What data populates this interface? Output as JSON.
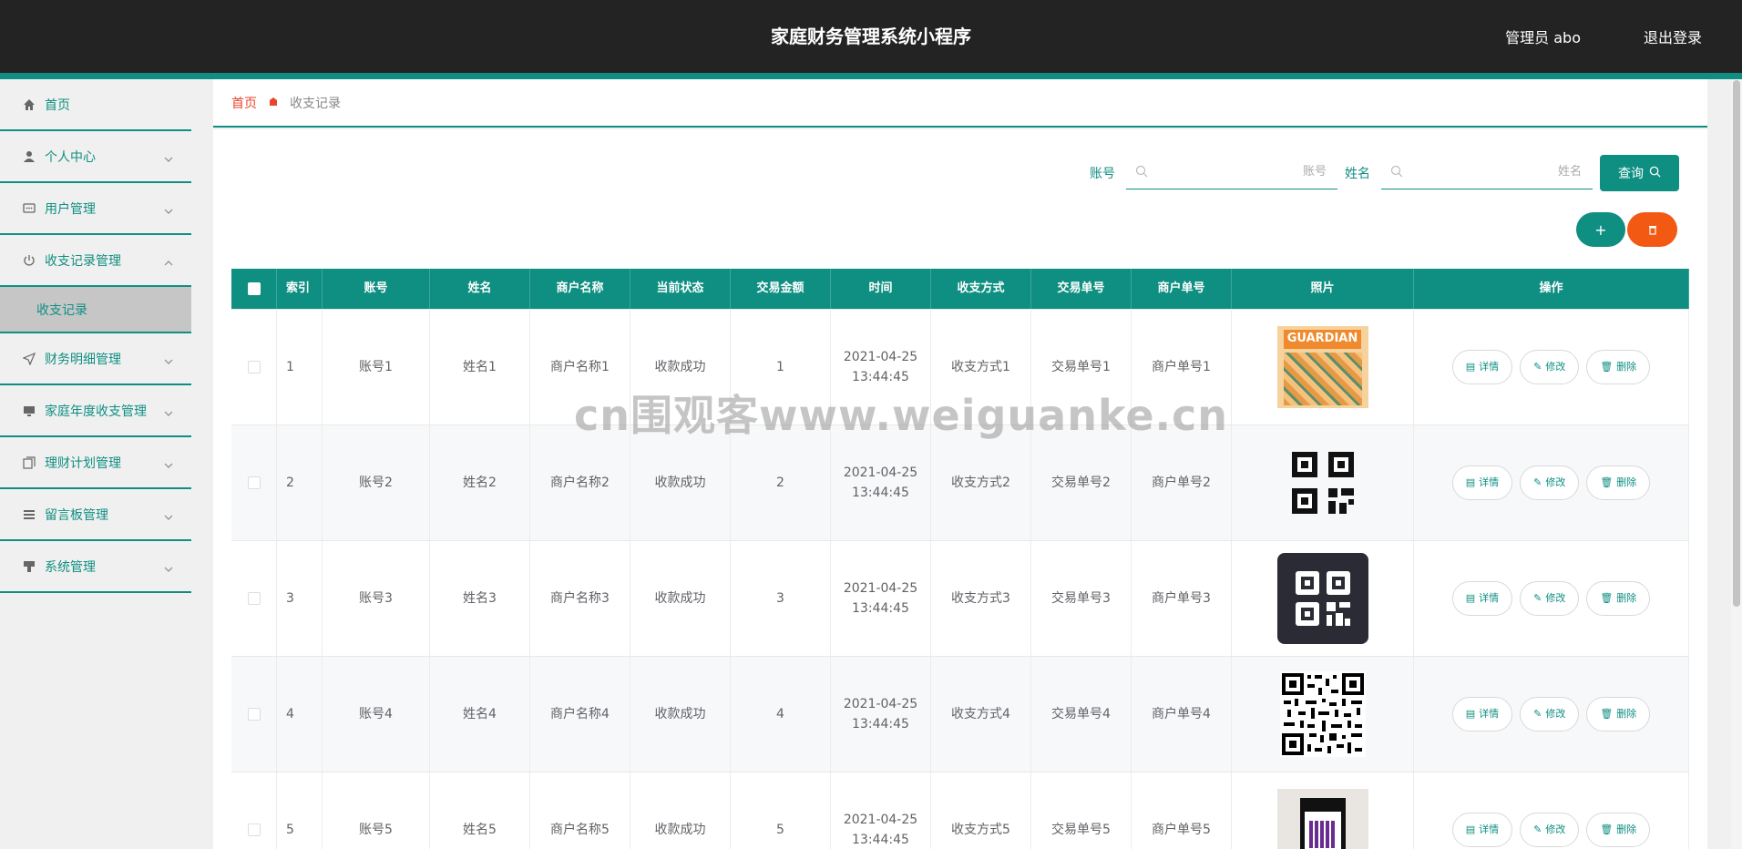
{
  "header": {
    "title": "家庭财务管理系统小程序",
    "user": "管理员 abo",
    "logout": "退出登录"
  },
  "sidebar": {
    "items": [
      {
        "label": "首页",
        "icon": "home-icon"
      },
      {
        "label": "个人中心",
        "icon": "user-icon"
      },
      {
        "label": "用户管理",
        "icon": "chat-icon"
      },
      {
        "label": "收支记录管理",
        "icon": "power-icon",
        "expanded": true
      },
      {
        "label": "财务明细管理",
        "icon": "send-icon"
      },
      {
        "label": "家庭年度收支管理",
        "icon": "monitor-icon"
      },
      {
        "label": "理财计划管理",
        "icon": "copy-icon"
      },
      {
        "label": "留言板管理",
        "icon": "list-icon"
      },
      {
        "label": "系统管理",
        "icon": "stamp-icon"
      }
    ],
    "sub_item": "收支记录"
  },
  "breadcrumb": {
    "home": "首页",
    "current": "收支记录"
  },
  "search": {
    "account_label": "账号",
    "account_placeholder": "账号",
    "name_label": "姓名",
    "name_placeholder": "姓名",
    "query_button": "查询"
  },
  "actions": {
    "add": "+"
  },
  "table": {
    "headers": [
      "索引",
      "账号",
      "姓名",
      "商户名称",
      "当前状态",
      "交易金额",
      "时间",
      "收支方式",
      "交易单号",
      "商户单号",
      "照片",
      "操作"
    ],
    "rows": [
      {
        "index": "1",
        "account": "账号1",
        "name": "姓名1",
        "merchant": "商户名称1",
        "status": "收款成功",
        "amount": "1",
        "date": "2021-04-25",
        "time": "13:44:45",
        "method": "收支方式1",
        "trade_no": "交易单号1",
        "merchant_no": "商户单号1",
        "photo": "guardian-poster"
      },
      {
        "index": "2",
        "account": "账号2",
        "name": "姓名2",
        "merchant": "商户名称2",
        "status": "收款成功",
        "amount": "2",
        "date": "2021-04-25",
        "time": "13:44:45",
        "method": "收支方式2",
        "trade_no": "交易单号2",
        "merchant_no": "商户单号2",
        "photo": "qr-icon-black"
      },
      {
        "index": "3",
        "account": "账号3",
        "name": "姓名3",
        "merchant": "商户名称3",
        "status": "收款成功",
        "amount": "3",
        "date": "2021-04-25",
        "time": "13:44:45",
        "method": "收支方式3",
        "trade_no": "交易单号3",
        "merchant_no": "商户单号3",
        "photo": "qr-icon-dark-tile"
      },
      {
        "index": "4",
        "account": "账号4",
        "name": "姓名4",
        "merchant": "商户名称4",
        "status": "收款成功",
        "amount": "4",
        "date": "2021-04-25",
        "time": "13:44:45",
        "method": "收支方式4",
        "trade_no": "交易单号4",
        "merchant_no": "商户单号4",
        "photo": "qr-code"
      },
      {
        "index": "5",
        "account": "账号5",
        "name": "姓名5",
        "merchant": "商户名称5",
        "status": "收款成功",
        "amount": "5",
        "date": "2021-04-25",
        "time": "13:44:45",
        "method": "收支方式5",
        "trade_no": "交易单号5",
        "merchant_no": "商户单号5",
        "photo": "framed-qr"
      }
    ],
    "ops": {
      "detail": "详情",
      "edit": "修改",
      "delete": "删除"
    }
  },
  "guardian_text": "GUARDIAN",
  "watermark": "cn围观客www.weiguanke.cn",
  "colors": {
    "primary": "#0f8f82",
    "danger": "#f25a14",
    "header": "#232323",
    "breadcrumb_home": "#e8452c"
  }
}
